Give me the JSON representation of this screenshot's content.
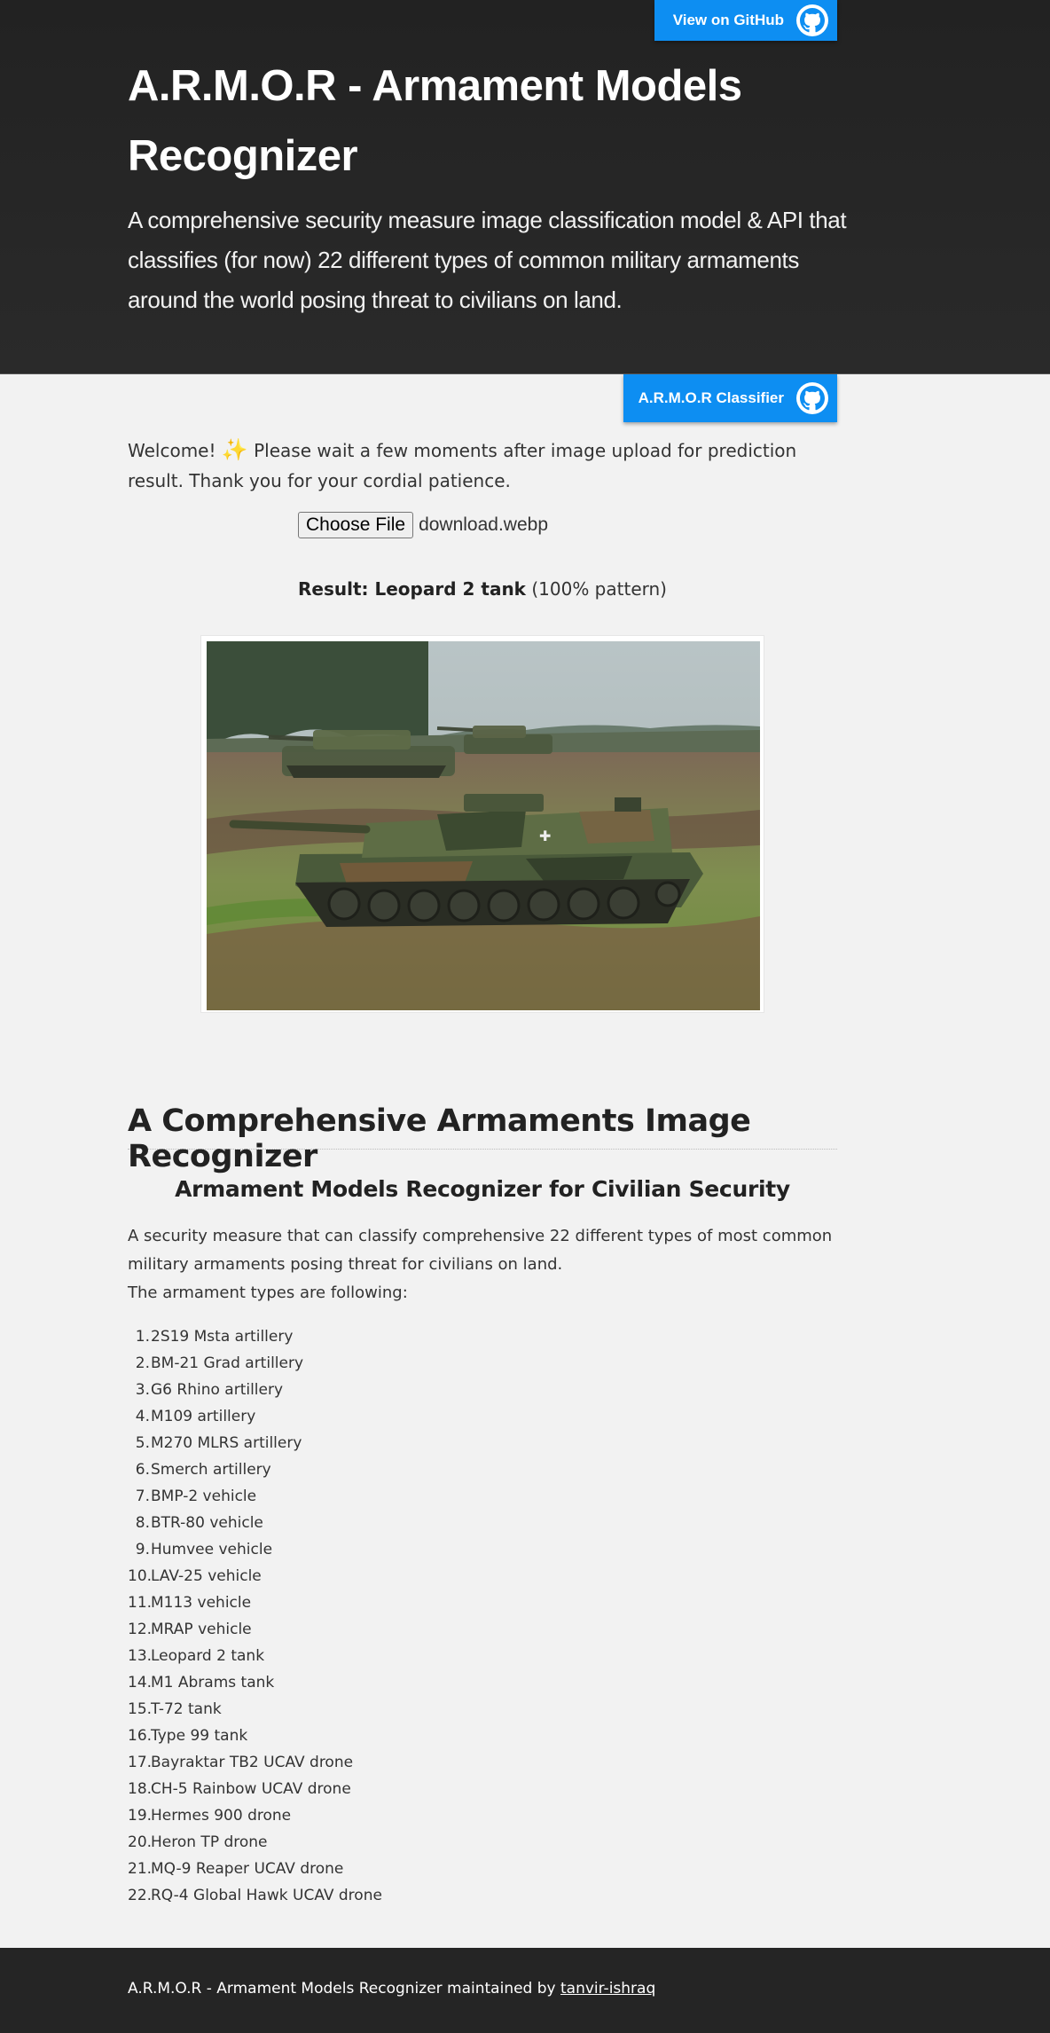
{
  "header": {
    "github_button": "View on GitHub",
    "title": "A.R.M.O.R - Armament Models Recognizer",
    "description": "A comprehensive security measure image classification model & API that classifies (for now) 22 different types of common military armaments around the world posing threat to civilians on land."
  },
  "classifier_button": "A.R.M.O.R Classifier",
  "welcome": {
    "text_before": "Welcome! ",
    "sparkle": "✨",
    "text_after": " Please wait a few moments after image upload for prediction result. Thank you for your cordial patience."
  },
  "upload": {
    "button_label": "Choose File",
    "file_name": "download.webp"
  },
  "result": {
    "label": "Result:",
    "value": "Leopard 2 tank",
    "confidence": "(100% pattern)"
  },
  "section": {
    "title": "A Comprehensive Armaments Image Recognizer",
    "subtitle": "Armament Models Recognizer for Civilian Security",
    "intro_line1": "A security measure that can classify comprehensive 22 different types of most common military armaments posing threat for civilians on land.",
    "intro_line2": "The armament types are following:"
  },
  "armaments": [
    "2S19 Msta artillery",
    "BM-21 Grad artillery",
    "G6 Rhino artillery",
    "M109 artillery",
    "M270 MLRS artillery",
    "Smerch artillery",
    "BMP-2 vehicle",
    "BTR-80 vehicle",
    "Humvee vehicle",
    "LAV-25 vehicle",
    "M113 vehicle",
    "MRAP vehicle",
    "Leopard 2 tank",
    "M1 Abrams tank",
    "T-72 tank",
    "Type 99 tank",
    "Bayraktar TB2 UCAV drone",
    "CH-5 Rainbow UCAV drone",
    "Hermes 900 drone",
    "Heron TP drone",
    "MQ-9 Reaper UCAV drone",
    "RQ-4 Global Hawk UCAV drone"
  ],
  "footer": {
    "text": "A.R.M.O.R - Armament Models Recognizer maintained by ",
    "link": "tanvir-ishraq"
  },
  "colors": {
    "accent": "#0d8ef2",
    "header_bg": "#262626",
    "page_bg": "#f2f2f2",
    "footer_bg": "#252525"
  },
  "icons": {
    "github": "github-octocat-icon",
    "sparkle": "sparkle-icon"
  }
}
